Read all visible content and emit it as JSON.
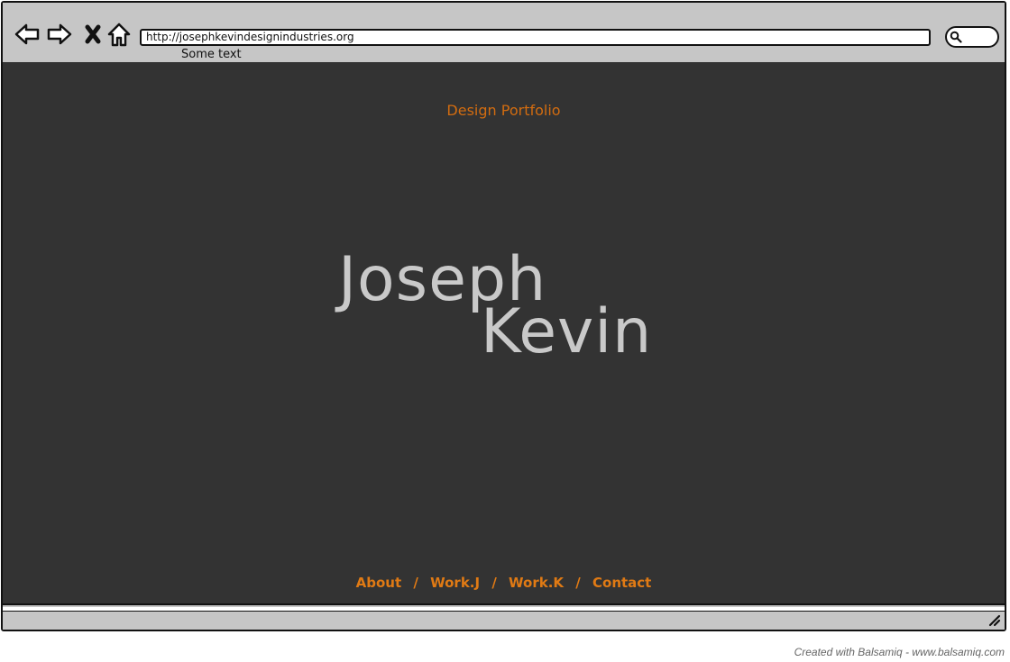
{
  "browser": {
    "url": "http://josephkevindesignindustries.org",
    "sub_text": "Some text",
    "icons": [
      "back-arrow-icon",
      "forward-arrow-icon",
      "close-icon",
      "home-icon",
      "search-icon",
      "resize-grip-icon"
    ]
  },
  "page": {
    "title": "Design Portfolio",
    "name_first": "Joseph",
    "name_last": "Kevin",
    "nav": {
      "about": "About",
      "work_j": "Work.J",
      "work_k": "Work.K",
      "contact": "Contact",
      "separator": "/"
    }
  },
  "colors": {
    "accent": "#e07a14",
    "background": "#333333",
    "name_text": "#c9c9c9"
  },
  "footer": {
    "credit": "Created with Balsamiq - www.balsamiq.com"
  }
}
